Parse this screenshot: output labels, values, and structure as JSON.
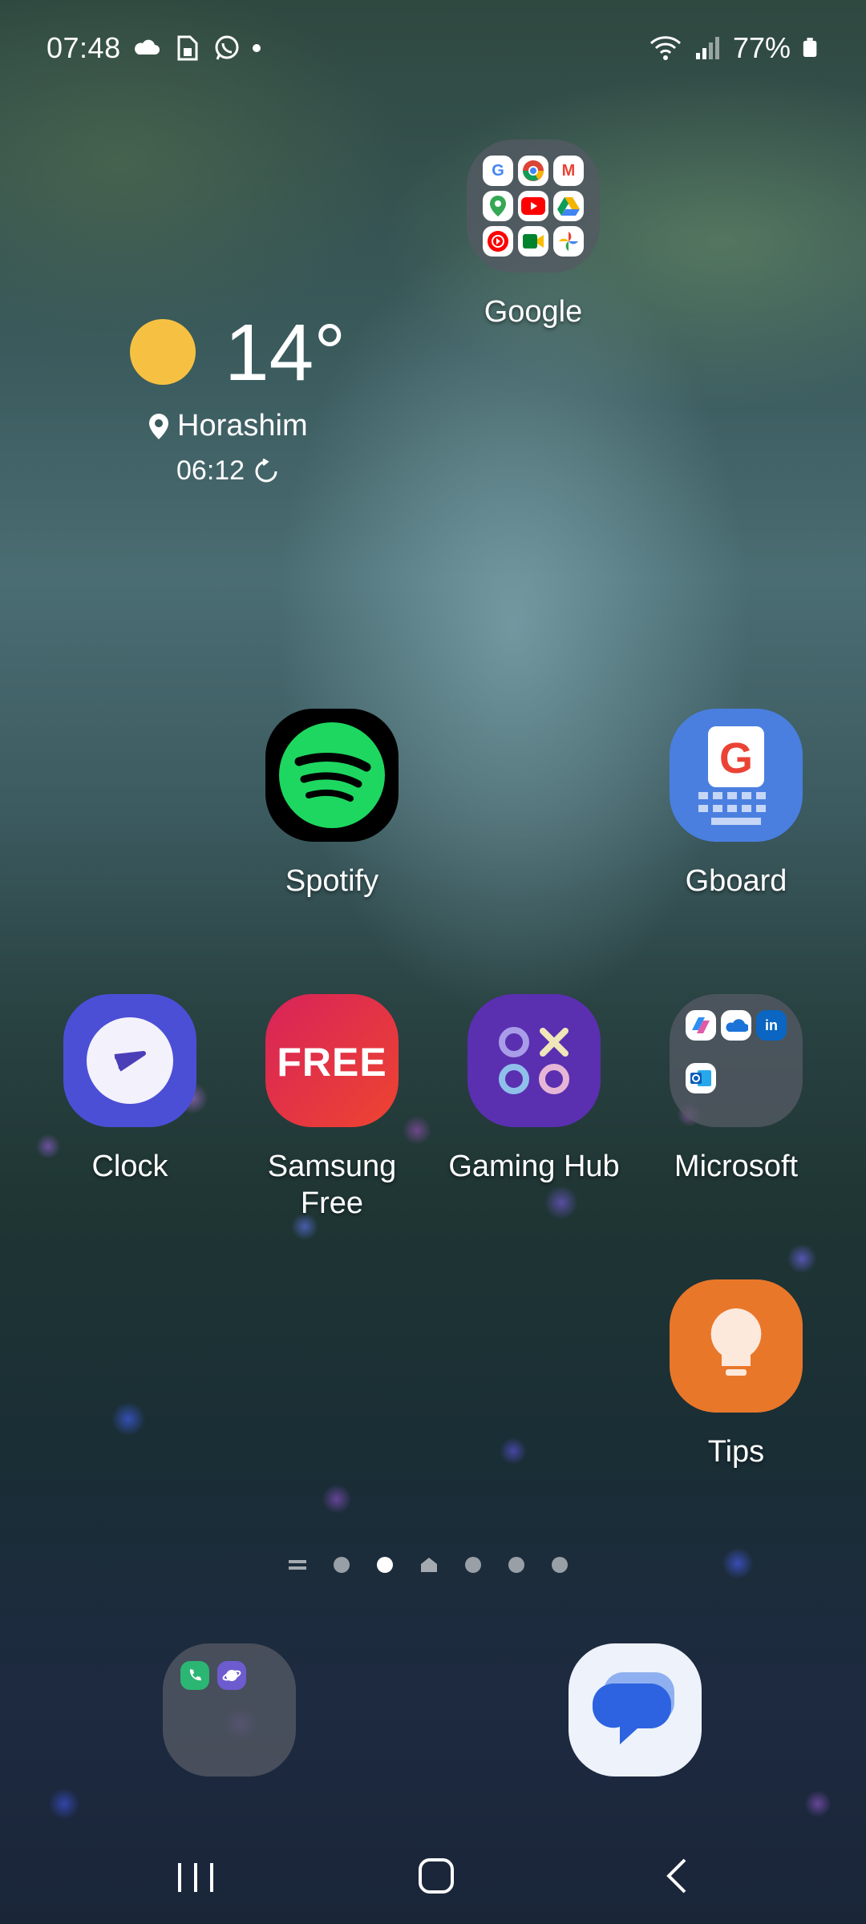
{
  "status_bar": {
    "time": "07:48",
    "battery": "77%",
    "icons_left": [
      "cloud-icon",
      "sim-icon",
      "whatsapp-icon",
      "dot-icon"
    ],
    "icons_right": [
      "wifi-icon",
      "signal-icon",
      "battery-icon"
    ]
  },
  "weather": {
    "temperature": "14°",
    "location": "Horashim",
    "updated": "06:12",
    "condition_icon": "sun-icon",
    "sun_color": "#f6c142"
  },
  "apps": {
    "google_folder": {
      "label": "Google"
    },
    "spotify": {
      "label": "Spotify"
    },
    "gboard": {
      "label": "Gboard"
    },
    "clock": {
      "label": "Clock"
    },
    "samsung_free": {
      "label": "Samsung Free",
      "icon_text": "FREE"
    },
    "gaming_hub": {
      "label": "Gaming Hub"
    },
    "microsoft_folder": {
      "label": "Microsoft"
    },
    "tips": {
      "label": "Tips"
    }
  },
  "page_indicator": {
    "pages": 6,
    "current": 2
  },
  "dock": {
    "folder_apps": [
      "phone-icon",
      "internet-icon"
    ],
    "messages_app": "messages-icon"
  },
  "nav": {
    "recent": "recent-apps-icon",
    "home": "home-icon",
    "back": "back-icon"
  },
  "colors": {
    "spotify": "#1ed760",
    "gboard": "#4a7fe0",
    "clock": "#4b4fd6",
    "samsung_free": "#e2324a",
    "gaming_hub": "#5a2fb0",
    "tips": "#e9772a",
    "messages": "#2d63e0"
  }
}
